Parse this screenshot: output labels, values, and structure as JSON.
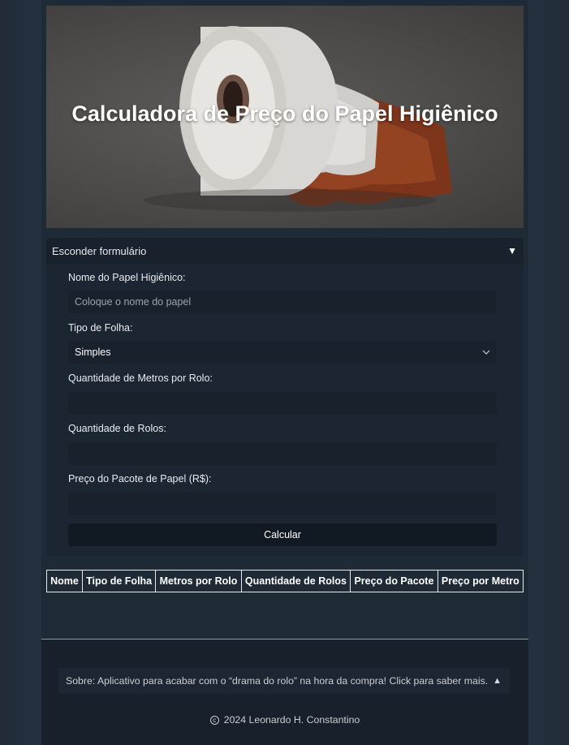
{
  "hero": {
    "title": "Calculadora de Preço do Papel Higiênico"
  },
  "form": {
    "toggle_label": "Esconder formulário",
    "toggle_icon": "triangle-down-icon",
    "name_label": "Nome do Papel Higiênico:",
    "name_placeholder": "Coloque o nome do papel",
    "name_value": "",
    "sheet_type_label": "Tipo de Folha:",
    "sheet_type_value": "Simples",
    "meters_label": "Quantidade de Metros por Rolo:",
    "meters_value": "",
    "rolls_label": "Quantidade de Rolos:",
    "rolls_value": "",
    "price_label": "Preço do Pacote de Papel (R$):",
    "price_value": "",
    "submit_label": "Calcular"
  },
  "table": {
    "columns": [
      "Nome",
      "Tipo de Folha",
      "Metros por Rolo",
      "Quantidade de Rolos",
      "Preço do Pacote",
      "Preço por Metro"
    ],
    "rows": []
  },
  "footer": {
    "about_text": "Sobre: Aplicativo para acabar com o “drama do rolo” na hora da compra! Click para saber mais.",
    "about_icon": "triangle-up-icon",
    "copyright_symbol": "c",
    "copyright_text": "2024 Leonardo H. Constantino"
  },
  "colors": {
    "page_bg": "#1f2a37",
    "panel_bg": "#1c2633",
    "input_bg": "#18212c",
    "button_bg": "#111a23",
    "footer_bg": "#18212b",
    "accent_stain": "#8b3a1e"
  }
}
